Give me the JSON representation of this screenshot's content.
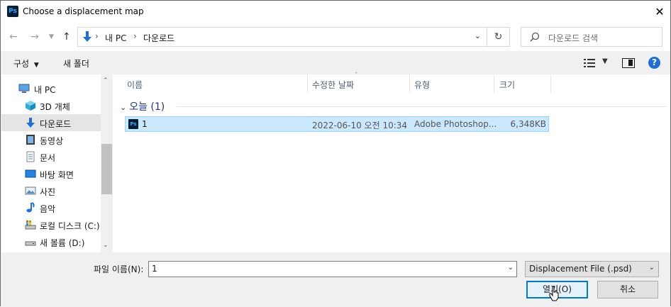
{
  "window": {
    "title": "Choose a displacement map",
    "app_badge": "Ps"
  },
  "nav": {
    "address": [
      "내 PC",
      "다운로드"
    ],
    "search_placeholder": "다운로드 검색"
  },
  "commands": {
    "organize": "구성",
    "new_folder": "새 폴더"
  },
  "sidebar": {
    "items": [
      {
        "label": "내 PC",
        "icon": "pc-icon"
      },
      {
        "label": "3D 개체",
        "icon": "cube-icon"
      },
      {
        "label": "다운로드",
        "icon": "download-icon",
        "selected": true
      },
      {
        "label": "동영상",
        "icon": "video-icon"
      },
      {
        "label": "문서",
        "icon": "document-icon"
      },
      {
        "label": "바탕 화면",
        "icon": "desktop-icon"
      },
      {
        "label": "사진",
        "icon": "picture-icon"
      },
      {
        "label": "음악",
        "icon": "music-icon"
      },
      {
        "label": "로컬 디스크 (C:)",
        "icon": "drive-icon"
      },
      {
        "label": "새 볼륨 (D:)",
        "icon": "drive-icon"
      }
    ]
  },
  "columns": {
    "name": "이름",
    "modified": "수정한 날짜",
    "type": "유형",
    "size": "크기"
  },
  "group": {
    "label": "오늘 (1)"
  },
  "files": [
    {
      "name": "1",
      "modified": "2022-06-10 오전 10:34",
      "type": "Adobe Photoshop...",
      "size": "6,348KB",
      "icon_badge": "Ps"
    }
  ],
  "footer": {
    "filename_label": "파일 이름(N):",
    "filename_value": "1",
    "filetype_value": "Displacement File (.psd)",
    "open_label": "열기(O)",
    "cancel_label": "취소"
  }
}
